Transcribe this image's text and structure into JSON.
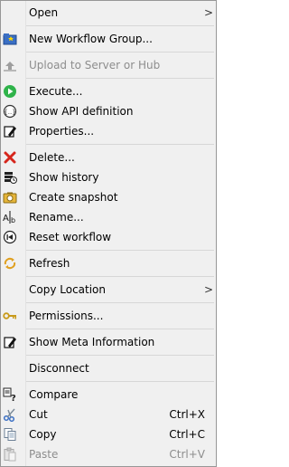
{
  "menu": {
    "open": "Open",
    "new_workflow_group": "New Workflow Group...",
    "upload": "Upload to Server or Hub",
    "execute": "Execute...",
    "show_api": "Show API definition",
    "properties": "Properties...",
    "delete": "Delete...",
    "show_history": "Show history",
    "create_snapshot": "Create snapshot",
    "rename": "Rename...",
    "reset_workflow": "Reset workflow",
    "refresh": "Refresh",
    "copy_location": "Copy Location",
    "permissions": "Permissions...",
    "show_meta": "Show Meta Information",
    "disconnect": "Disconnect",
    "compare": "Compare",
    "cut": "Cut",
    "cut_shortcut": "Ctrl+X",
    "copy": "Copy",
    "copy_shortcut": "Ctrl+C",
    "paste": "Paste",
    "paste_shortcut": "Ctrl+V",
    "submenu_arrow": ">"
  }
}
